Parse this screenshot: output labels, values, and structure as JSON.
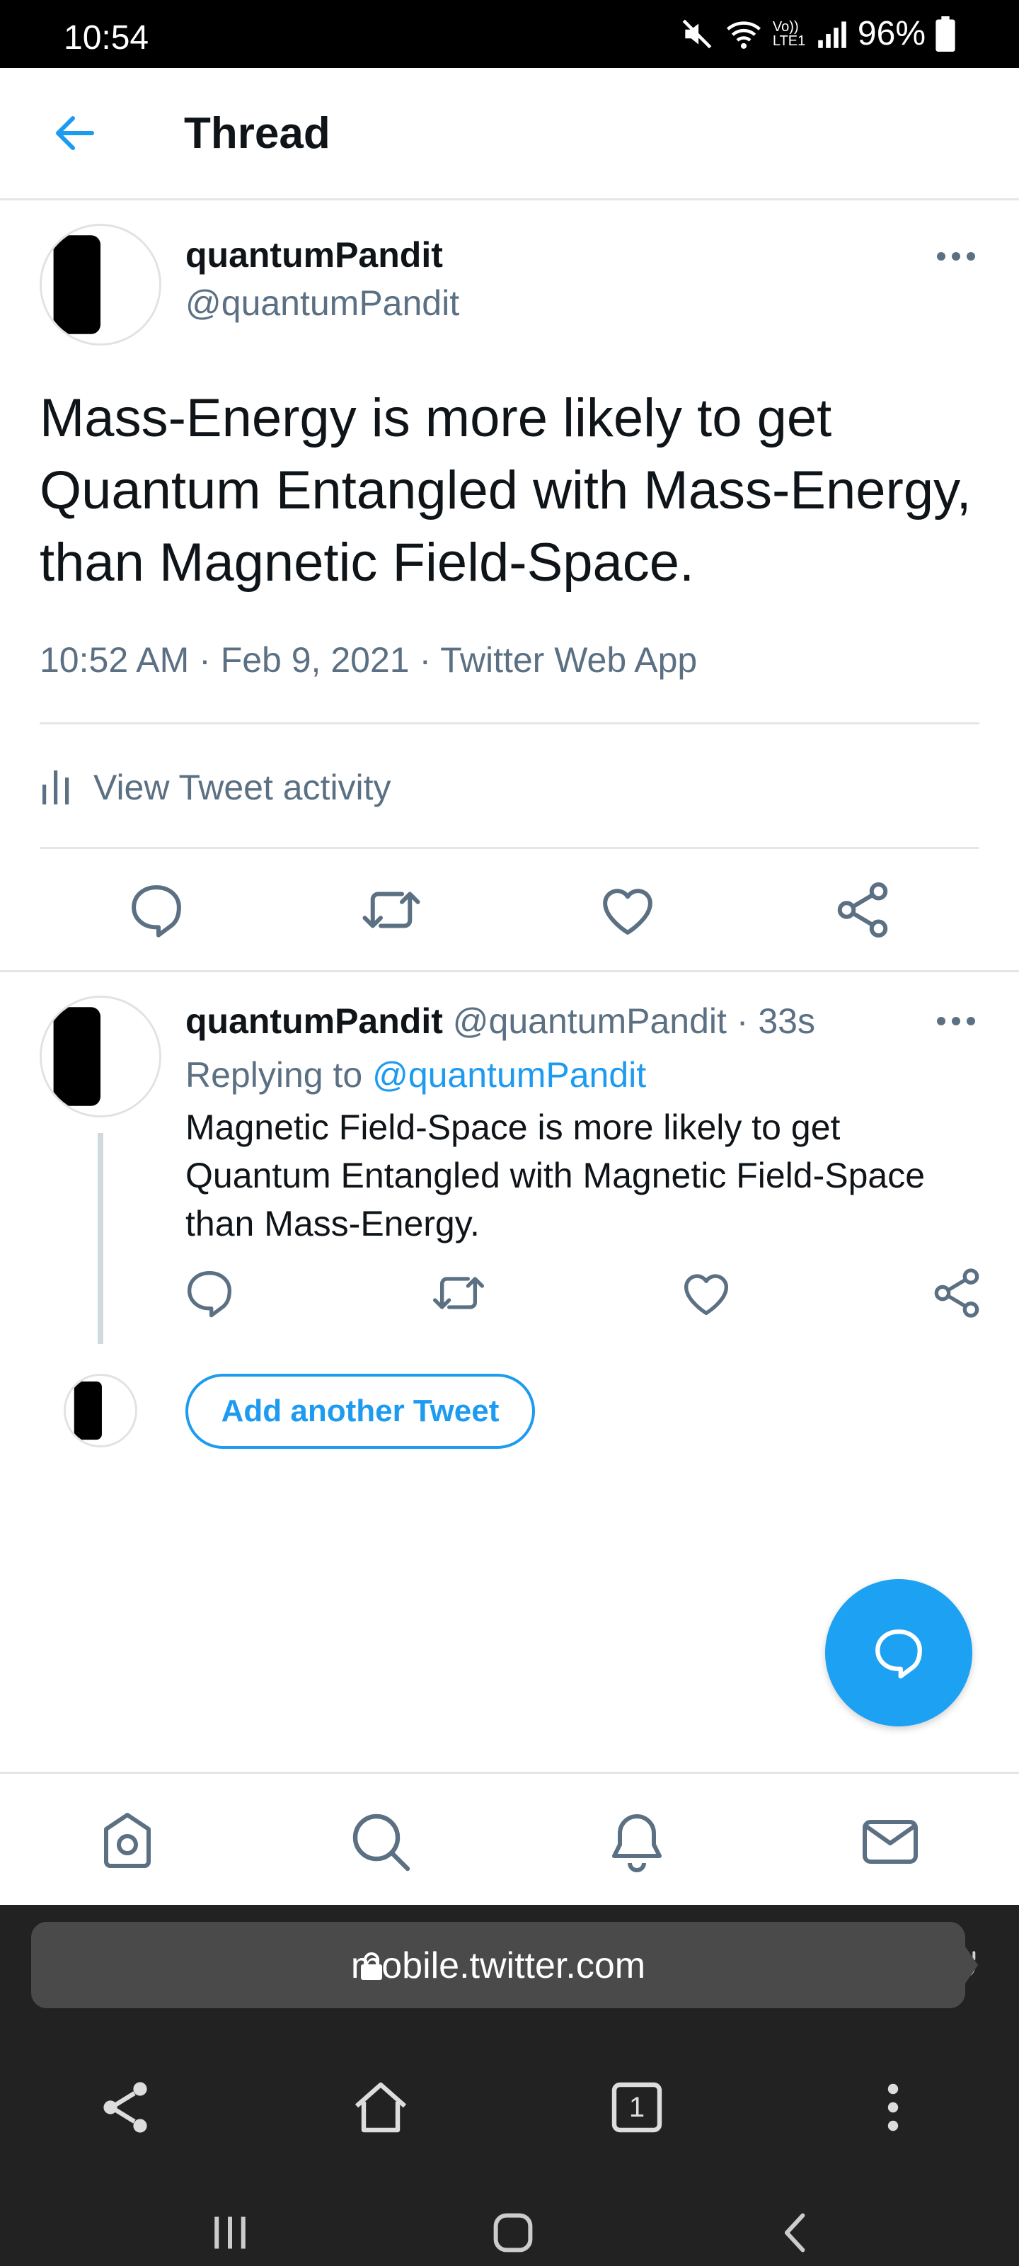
{
  "status_bar": {
    "time": "10:54",
    "network_label": "Vo)) LTE1",
    "battery": "96%"
  },
  "header": {
    "title": "Thread"
  },
  "main_tweet": {
    "name": "quantumPandit",
    "handle": "@quantumPandit",
    "text": "Mass-Energy is more likely to get Quantum Entangled with Mass-Energy, than Magnetic Field-Space.",
    "meta": "10:52 AM · Feb 9, 2021 · Twitter Web App",
    "activity_label": "View Tweet activity"
  },
  "reply_tweet": {
    "name": "quantumPandit",
    "handle": "@quantumPandit",
    "time": "33s",
    "replying_prefix": "Replying to",
    "replying_to": "@quantumPandit",
    "text": "Magnetic Field-Space is more likely to get Quantum Entangled with Magnetic Field-Space than Mass-Energy."
  },
  "compose": {
    "add_tweet_label": "Add another Tweet"
  },
  "browser": {
    "url": "mobile.twitter.com",
    "tab_count": "1"
  },
  "icons": {
    "actions": [
      "reply-icon",
      "retweet-icon",
      "like-icon",
      "share-icon"
    ],
    "nav": [
      "home-icon",
      "search-icon",
      "notifications-icon",
      "messages-icon"
    ]
  },
  "colors": {
    "accent": "#1d9bf0",
    "fab": "#1da1f2",
    "secondary_text": "#5b7083",
    "browser_bar": "#222222"
  }
}
